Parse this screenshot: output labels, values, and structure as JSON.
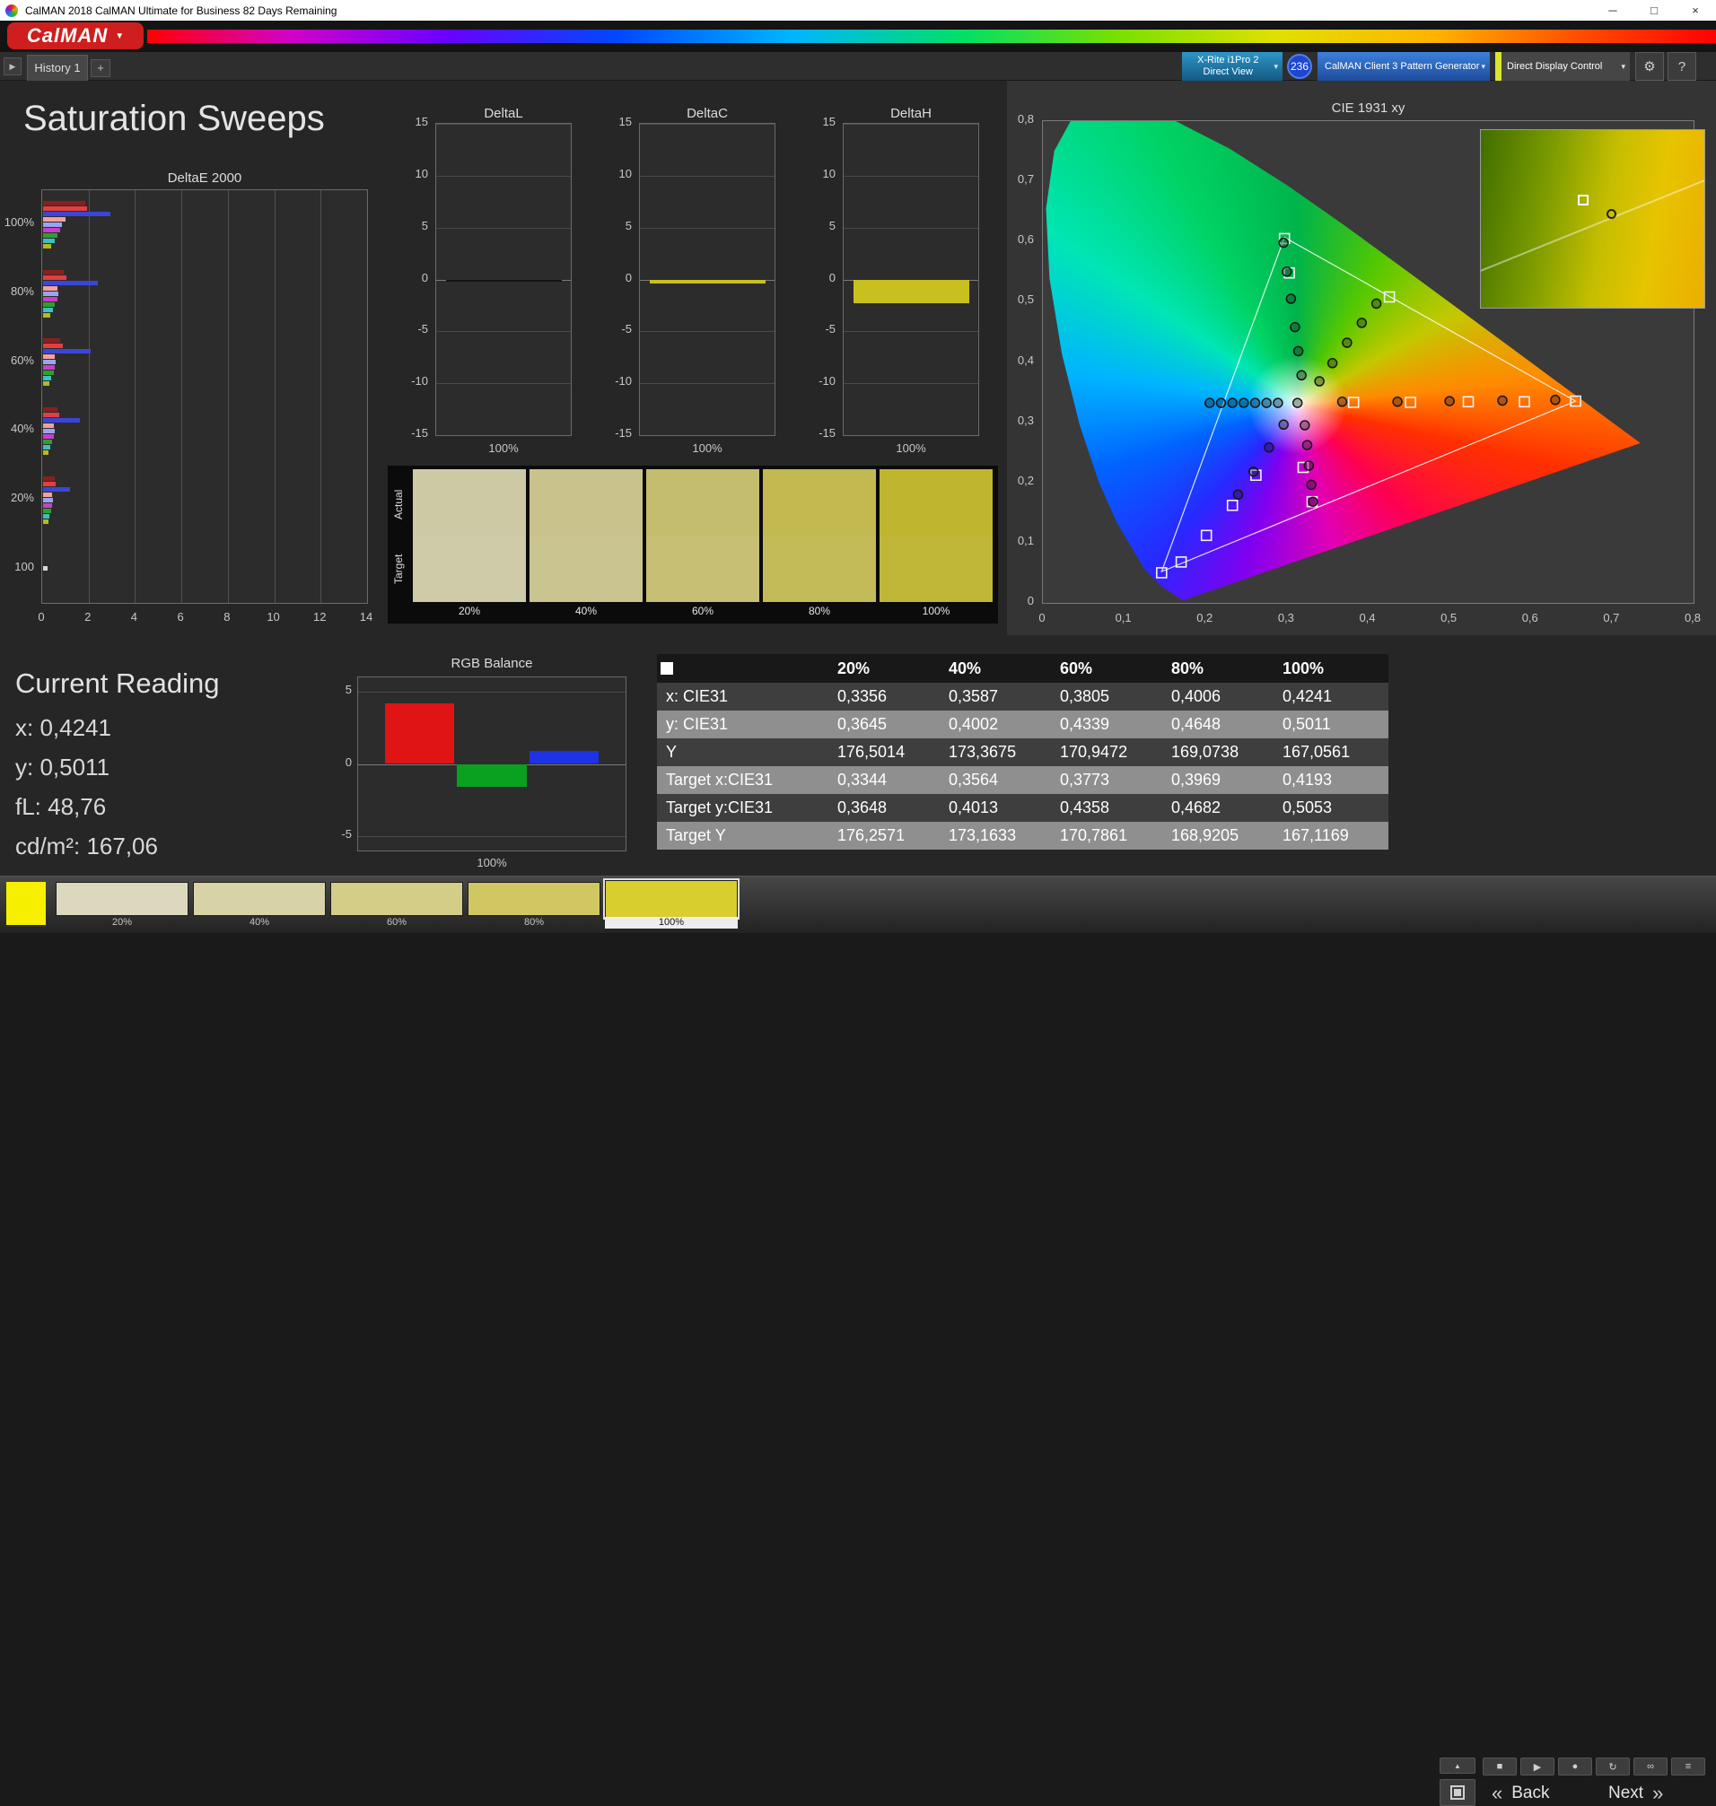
{
  "window": {
    "title": "CalMAN 2018 CalMAN Ultimate for Business 82 Days Remaining",
    "controls": {
      "minimize": "─",
      "maximize": "□",
      "close": "×"
    }
  },
  "brand": {
    "logo_text": "CalMAN",
    "dropdown": "▼"
  },
  "tabbar": {
    "collapse_icon": "▶",
    "history_tab": "History 1",
    "add_tab": "+",
    "meter_line1": "X-Rite i1Pro 2",
    "meter_line2": "Direct View",
    "badge": "236",
    "pattern_source": "CalMAN Client 3 Pattern Generator",
    "display_control": "Direct Display Control",
    "gear_icon": "⚙",
    "help_icon": "?",
    "dropdown_icon": "▾"
  },
  "page": {
    "title": "Saturation Sweeps"
  },
  "deltae": {
    "title": "DeltaE 2000",
    "x_ticks": [
      "0",
      "2",
      "4",
      "6",
      "8",
      "10",
      "12",
      "14"
    ],
    "x_max": 14,
    "groups": [
      {
        "label": "100%",
        "bars": [
          {
            "color": "#8a1f1f",
            "value": 1.8
          },
          {
            "color": "#e04040",
            "value": 1.9
          },
          {
            "color": "#3a46d8",
            "value": 2.9
          },
          {
            "color": "#f2a0a0",
            "value": 0.95
          },
          {
            "color": "#9aa4f2",
            "value": 0.8
          },
          {
            "color": "#c840c8",
            "value": 0.75
          },
          {
            "color": "#2f9e2f",
            "value": 0.6
          },
          {
            "color": "#3cc0c0",
            "value": 0.5
          },
          {
            "color": "#b8b820",
            "value": 0.35
          }
        ]
      },
      {
        "label": "80%",
        "bars": [
          {
            "color": "#8a1f1f",
            "value": 0.9
          },
          {
            "color": "#e04040",
            "value": 1.0
          },
          {
            "color": "#3a46d8",
            "value": 2.35
          },
          {
            "color": "#f2a0a0",
            "value": 0.62
          },
          {
            "color": "#9aa4f2",
            "value": 0.66
          },
          {
            "color": "#c840c8",
            "value": 0.6
          },
          {
            "color": "#2f9e2f",
            "value": 0.5
          },
          {
            "color": "#3cc0c0",
            "value": 0.42
          },
          {
            "color": "#b8b820",
            "value": 0.3
          }
        ]
      },
      {
        "label": "60%",
        "bars": [
          {
            "color": "#8a1f1f",
            "value": 0.75
          },
          {
            "color": "#e04040",
            "value": 0.85
          },
          {
            "color": "#3a46d8",
            "value": 2.05
          },
          {
            "color": "#f2a0a0",
            "value": 0.52
          },
          {
            "color": "#9aa4f2",
            "value": 0.56
          },
          {
            "color": "#c840c8",
            "value": 0.5
          },
          {
            "color": "#2f9e2f",
            "value": 0.45
          },
          {
            "color": "#3cc0c0",
            "value": 0.36
          },
          {
            "color": "#b8b820",
            "value": 0.28
          }
        ]
      },
      {
        "label": "40%",
        "bars": [
          {
            "color": "#8a1f1f",
            "value": 0.62
          },
          {
            "color": "#e04040",
            "value": 0.7
          },
          {
            "color": "#3a46d8",
            "value": 1.6
          },
          {
            "color": "#f2a0a0",
            "value": 0.46
          },
          {
            "color": "#9aa4f2",
            "value": 0.5
          },
          {
            "color": "#c840c8",
            "value": 0.45
          },
          {
            "color": "#2f9e2f",
            "value": 0.4
          },
          {
            "color": "#3cc0c0",
            "value": 0.32
          },
          {
            "color": "#b8b820",
            "value": 0.25
          }
        ]
      },
      {
        "label": "20%",
        "bars": [
          {
            "color": "#8a1f1f",
            "value": 0.5
          },
          {
            "color": "#e04040",
            "value": 0.56
          },
          {
            "color": "#3a46d8",
            "value": 1.15
          },
          {
            "color": "#f2a0a0",
            "value": 0.4
          },
          {
            "color": "#9aa4f2",
            "value": 0.44
          },
          {
            "color": "#c840c8",
            "value": 0.38
          },
          {
            "color": "#2f9e2f",
            "value": 0.34
          },
          {
            "color": "#3cc0c0",
            "value": 0.28
          },
          {
            "color": "#b8b820",
            "value": 0.22
          }
        ]
      },
      {
        "label": "100",
        "bars": [
          {
            "color": "#d8d8d8",
            "value": 0.2
          }
        ]
      }
    ]
  },
  "delta_charts": [
    {
      "title": "DeltaL",
      "xlabel": "100%",
      "ticks": [
        15,
        10,
        5,
        0,
        -5,
        -10,
        -15
      ],
      "range": 15,
      "value": -0.2,
      "color": "#141414"
    },
    {
      "title": "DeltaC",
      "xlabel": "100%",
      "ticks": [
        15,
        10,
        5,
        0,
        -5,
        -10,
        -15
      ],
      "range": 15,
      "value": -0.35,
      "color": "#c8c01e"
    },
    {
      "title": "DeltaH",
      "xlabel": "100%",
      "ticks": [
        15,
        10,
        5,
        0,
        -5,
        -10,
        -15
      ],
      "range": 15,
      "value": -2.3,
      "color": "#c8c01e"
    }
  ],
  "swatch_panel": {
    "row_labels": [
      "Actual",
      "Target"
    ],
    "columns": [
      {
        "label": "20%",
        "actual": "#cdc9a4",
        "target": "#cfcba8"
      },
      {
        "label": "40%",
        "actual": "#c9c28c",
        "target": "#cac491"
      },
      {
        "label": "60%",
        "actual": "#c5bd6e",
        "target": "#c6bf74"
      },
      {
        "label": "80%",
        "actual": "#c2b950",
        "target": "#c3bb58"
      },
      {
        "label": "100%",
        "actual": "#bfb52e",
        "target": "#c0b738"
      }
    ]
  },
  "cie": {
    "title": "CIE 1931 xy",
    "x_ticks": [
      "0",
      "0,1",
      "0,2",
      "0,3",
      "0,4",
      "0,5",
      "0,6",
      "0,7",
      "0,8"
    ],
    "y_ticks": [
      "0,8",
      "0,7",
      "0,6",
      "0,5",
      "0,4",
      "0,3",
      "0,2",
      "0,1",
      "0"
    ],
    "axis_max": 0.8,
    "white_point": [
      0.3127,
      0.329
    ],
    "triangle": [
      [
        0.655,
        0.335
      ],
      [
        0.297,
        0.607
      ],
      [
        0.146,
        0.052
      ]
    ],
    "points": [
      [
        0.205,
        0.332
      ],
      [
        0.219,
        0.332
      ],
      [
        0.233,
        0.332
      ],
      [
        0.247,
        0.332
      ],
      [
        0.261,
        0.332
      ],
      [
        0.275,
        0.332
      ],
      [
        0.289,
        0.332
      ],
      [
        0.313,
        0.332
      ],
      [
        0.368,
        0.334
      ],
      [
        0.436,
        0.334
      ],
      [
        0.5,
        0.335
      ],
      [
        0.565,
        0.336
      ],
      [
        0.63,
        0.337
      ],
      [
        0.318,
        0.378
      ],
      [
        0.314,
        0.418
      ],
      [
        0.31,
        0.458
      ],
      [
        0.305,
        0.505
      ],
      [
        0.3,
        0.55
      ],
      [
        0.296,
        0.598
      ],
      [
        0.34,
        0.368
      ],
      [
        0.356,
        0.398
      ],
      [
        0.374,
        0.432
      ],
      [
        0.392,
        0.465
      ],
      [
        0.41,
        0.497
      ],
      [
        0.322,
        0.295
      ],
      [
        0.325,
        0.262
      ],
      [
        0.327,
        0.228
      ],
      [
        0.33,
        0.196
      ],
      [
        0.332,
        0.168
      ],
      [
        0.296,
        0.296
      ],
      [
        0.278,
        0.258
      ],
      [
        0.259,
        0.218
      ],
      [
        0.24,
        0.18
      ]
    ],
    "targets": [
      [
        0.313,
        0.332
      ],
      [
        0.382,
        0.333
      ],
      [
        0.452,
        0.333
      ],
      [
        0.523,
        0.334
      ],
      [
        0.592,
        0.334
      ],
      [
        0.655,
        0.335
      ],
      [
        0.303,
        0.548
      ],
      [
        0.297,
        0.605
      ],
      [
        0.426,
        0.508
      ],
      [
        0.32,
        0.225
      ],
      [
        0.331,
        0.168
      ],
      [
        0.262,
        0.212
      ],
      [
        0.233,
        0.162
      ],
      [
        0.201,
        0.112
      ],
      [
        0.17,
        0.068
      ],
      [
        0.146,
        0.05
      ]
    ],
    "inset": {
      "square": [
        0.46,
        0.4
      ],
      "circle": [
        0.585,
        0.475
      ]
    }
  },
  "current_reading": {
    "title": "Current Reading",
    "lines": [
      "x: 0,4241",
      "y: 0,5011",
      "fL: 48,76",
      "cd/m²: 167,06"
    ]
  },
  "rgb_balance": {
    "title": "RGB Balance",
    "xlabel": "100%",
    "ticks": [
      5,
      0,
      -5
    ],
    "range": 6,
    "bars": [
      {
        "name": "red",
        "color": "#e01414",
        "value": 4.2
      },
      {
        "name": "green",
        "color": "#0aa020",
        "value": -1.6
      },
      {
        "name": "blue",
        "color": "#1e32e6",
        "value": 0.9
      }
    ]
  },
  "table": {
    "columns": [
      "20%",
      "40%",
      "60%",
      "80%",
      "100%"
    ],
    "rows": [
      {
        "label": "x: CIE31",
        "values": [
          "0,3356",
          "0,3587",
          "0,3805",
          "0,4006",
          "0,4241"
        ]
      },
      {
        "label": "y: CIE31",
        "values": [
          "0,3645",
          "0,4002",
          "0,4339",
          "0,4648",
          "0,5011"
        ]
      },
      {
        "label": "Y",
        "values": [
          "176,5014",
          "173,3675",
          "170,9472",
          "169,0738",
          "167,0561"
        ]
      },
      {
        "label": "Target x:CIE31",
        "values": [
          "0,3344",
          "0,3564",
          "0,3773",
          "0,3969",
          "0,4193"
        ]
      },
      {
        "label": "Target y:CIE31",
        "values": [
          "0,3648",
          "0,4013",
          "0,4358",
          "0,4682",
          "0,5053"
        ]
      },
      {
        "label": "Target Y",
        "values": [
          "176,2571",
          "173,1633",
          "170,7861",
          "168,9205",
          "167,1169"
        ]
      }
    ]
  },
  "bottom": {
    "preview_color": "#f7ef00",
    "swatches": [
      {
        "label": "20%",
        "color": "#dbd8bd",
        "selected": false
      },
      {
        "label": "40%",
        "color": "#d8d3a6",
        "selected": false
      },
      {
        "label": "60%",
        "color": "#d4cd88",
        "selected": false
      },
      {
        "label": "80%",
        "color": "#d0c763",
        "selected": false
      },
      {
        "label": "100%",
        "color": "#d8cf2e",
        "selected": true
      }
    ],
    "transport": [
      {
        "name": "stop",
        "glyph": "■"
      },
      {
        "name": "play",
        "glyph": "▶"
      },
      {
        "name": "record",
        "glyph": "●"
      },
      {
        "name": "repeat",
        "glyph": "↻"
      },
      {
        "name": "continuous",
        "glyph": "∞"
      },
      {
        "name": "menu",
        "glyph": "≡"
      }
    ],
    "up_icon": "▲",
    "back_icon": "«",
    "back_label": "Back",
    "next_label": "Next",
    "next_icon": "»"
  }
}
